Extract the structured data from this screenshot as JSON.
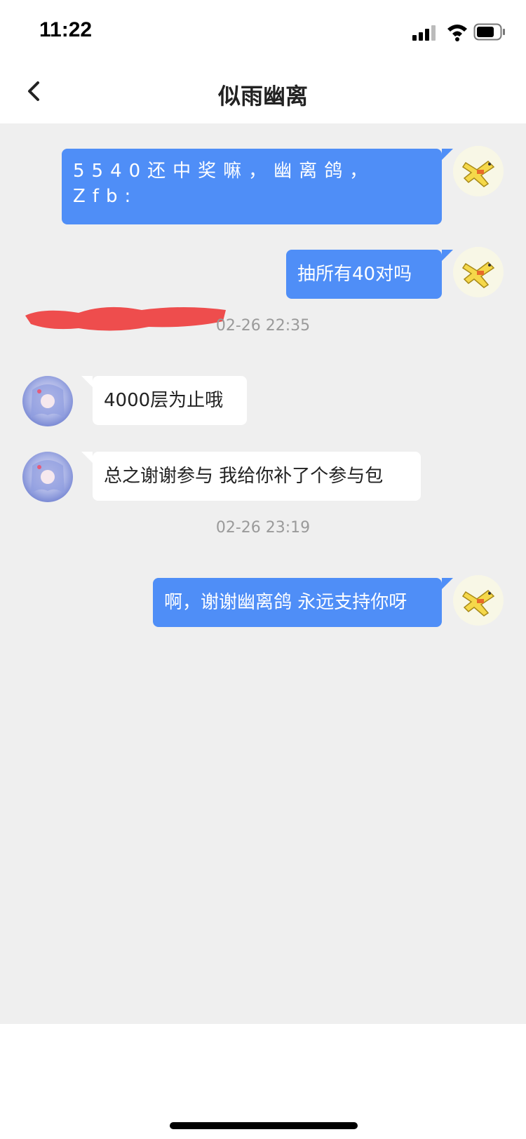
{
  "status_bar": {
    "time": "11:22",
    "icons": [
      "signal-icon",
      "wifi-icon",
      "battery-icon"
    ]
  },
  "nav": {
    "back_icon": "chevron-left-icon",
    "title": "似雨幽离"
  },
  "colors": {
    "sent_bubble": "#4f8ef7",
    "received_bubble": "#ffffff",
    "chat_background": "#efefef",
    "timestamp": "#9a9a9a"
  },
  "messages": [
    {
      "sender": "me",
      "text": "5540还中奖嘛，幽离鸽，Zfb:",
      "redacted": true
    },
    {
      "sender": "me",
      "text": "抽所有40对吗"
    },
    {
      "type": "timestamp",
      "text": "02-26 22:35"
    },
    {
      "sender": "other",
      "text": "4000层为止哦"
    },
    {
      "sender": "other",
      "text": "总之谢谢参与 我给你补了个参与包"
    },
    {
      "type": "timestamp",
      "text": "02-26 23:19"
    },
    {
      "sender": "me",
      "text": "啊，谢谢幽离鸽 永远支持你呀"
    }
  ]
}
